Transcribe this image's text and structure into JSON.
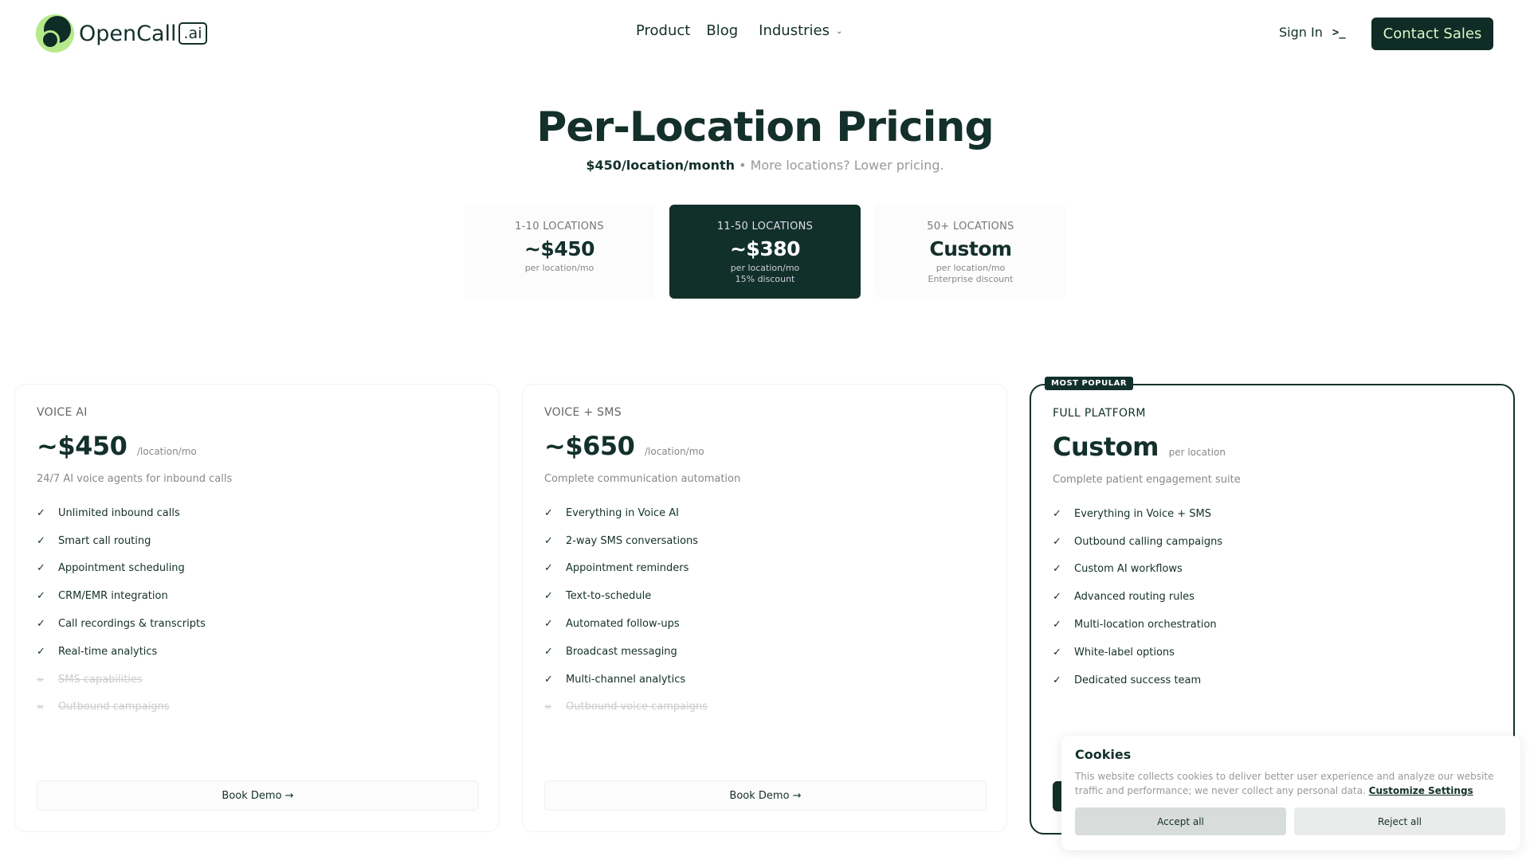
{
  "header": {
    "logo_text": "OpenCall",
    "logo_badge": ".ai",
    "nav": [
      "Product",
      "Blog",
      "Industries"
    ],
    "sign_in": "Sign In",
    "terminal_glyph": ">_",
    "contact": "Contact Sales"
  },
  "hero": {
    "title": "Per-Location Pricing",
    "price_strong": "$450/location/month",
    "price_rest": " • More locations? Lower pricing."
  },
  "tiers": [
    {
      "label": "1-10 LOCATIONS",
      "price": "~$450",
      "small1": "per location/mo",
      "small2": ""
    },
    {
      "label": "11-50 LOCATIONS",
      "price": "~$380",
      "small1": "per location/mo",
      "small2": "15% discount"
    },
    {
      "label": "50+ LOCATIONS",
      "price": "Custom",
      "small1": "per location/mo",
      "small2": "Enterprise discount"
    }
  ],
  "plans": [
    {
      "name": "VOICE AI",
      "price": "~$450",
      "unit": "/location/mo",
      "desc": "24/7 AI voice agents for inbound calls",
      "features": [
        {
          "text": "Unlimited inbound calls",
          "on": true
        },
        {
          "text": "Smart call routing",
          "on": true
        },
        {
          "text": "Appointment scheduling",
          "on": true
        },
        {
          "text": "CRM/EMR integration",
          "on": true
        },
        {
          "text": "Call recordings & transcripts",
          "on": true
        },
        {
          "text": "Real-time analytics",
          "on": true
        },
        {
          "text": "SMS capabilities",
          "on": false
        },
        {
          "text": "Outbound campaigns",
          "on": false
        }
      ],
      "button": "Book Demo →"
    },
    {
      "name": "VOICE + SMS",
      "price": "~$650",
      "unit": "/location/mo",
      "desc": "Complete communication automation",
      "features": [
        {
          "text": "Everything in Voice AI",
          "on": true
        },
        {
          "text": "2-way SMS conversations",
          "on": true
        },
        {
          "text": "Appointment reminders",
          "on": true
        },
        {
          "text": "Text-to-schedule",
          "on": true
        },
        {
          "text": "Automated follow-ups",
          "on": true
        },
        {
          "text": "Broadcast messaging",
          "on": true
        },
        {
          "text": "Multi-channel analytics",
          "on": true
        },
        {
          "text": "Outbound voice campaigns",
          "on": false
        }
      ],
      "button": "Book Demo →"
    },
    {
      "badge": "MOST POPULAR",
      "name": "FULL PLATFORM",
      "price": "Custom",
      "unit": "per location",
      "desc": "Complete patient engagement suite",
      "features": [
        {
          "text": "Everything in Voice + SMS",
          "on": true
        },
        {
          "text": "Outbound calling campaigns",
          "on": true
        },
        {
          "text": "Custom AI workflows",
          "on": true
        },
        {
          "text": "Advanced routing rules",
          "on": true
        },
        {
          "text": "Multi-location orchestration",
          "on": true
        },
        {
          "text": "White-label options",
          "on": true
        },
        {
          "text": "Dedicated success team",
          "on": true
        }
      ]
    }
  ],
  "cookie": {
    "title": "Cookies",
    "text": "This website collects cookies to deliver better user experience and analyze our website traffic and performance; we never collect any personal data.",
    "link": "Customize Settings",
    "accept": "Accept all",
    "reject": "Reject all"
  },
  "icons": {
    "check": "✓",
    "cross": "×",
    "chevron": "⌄"
  }
}
